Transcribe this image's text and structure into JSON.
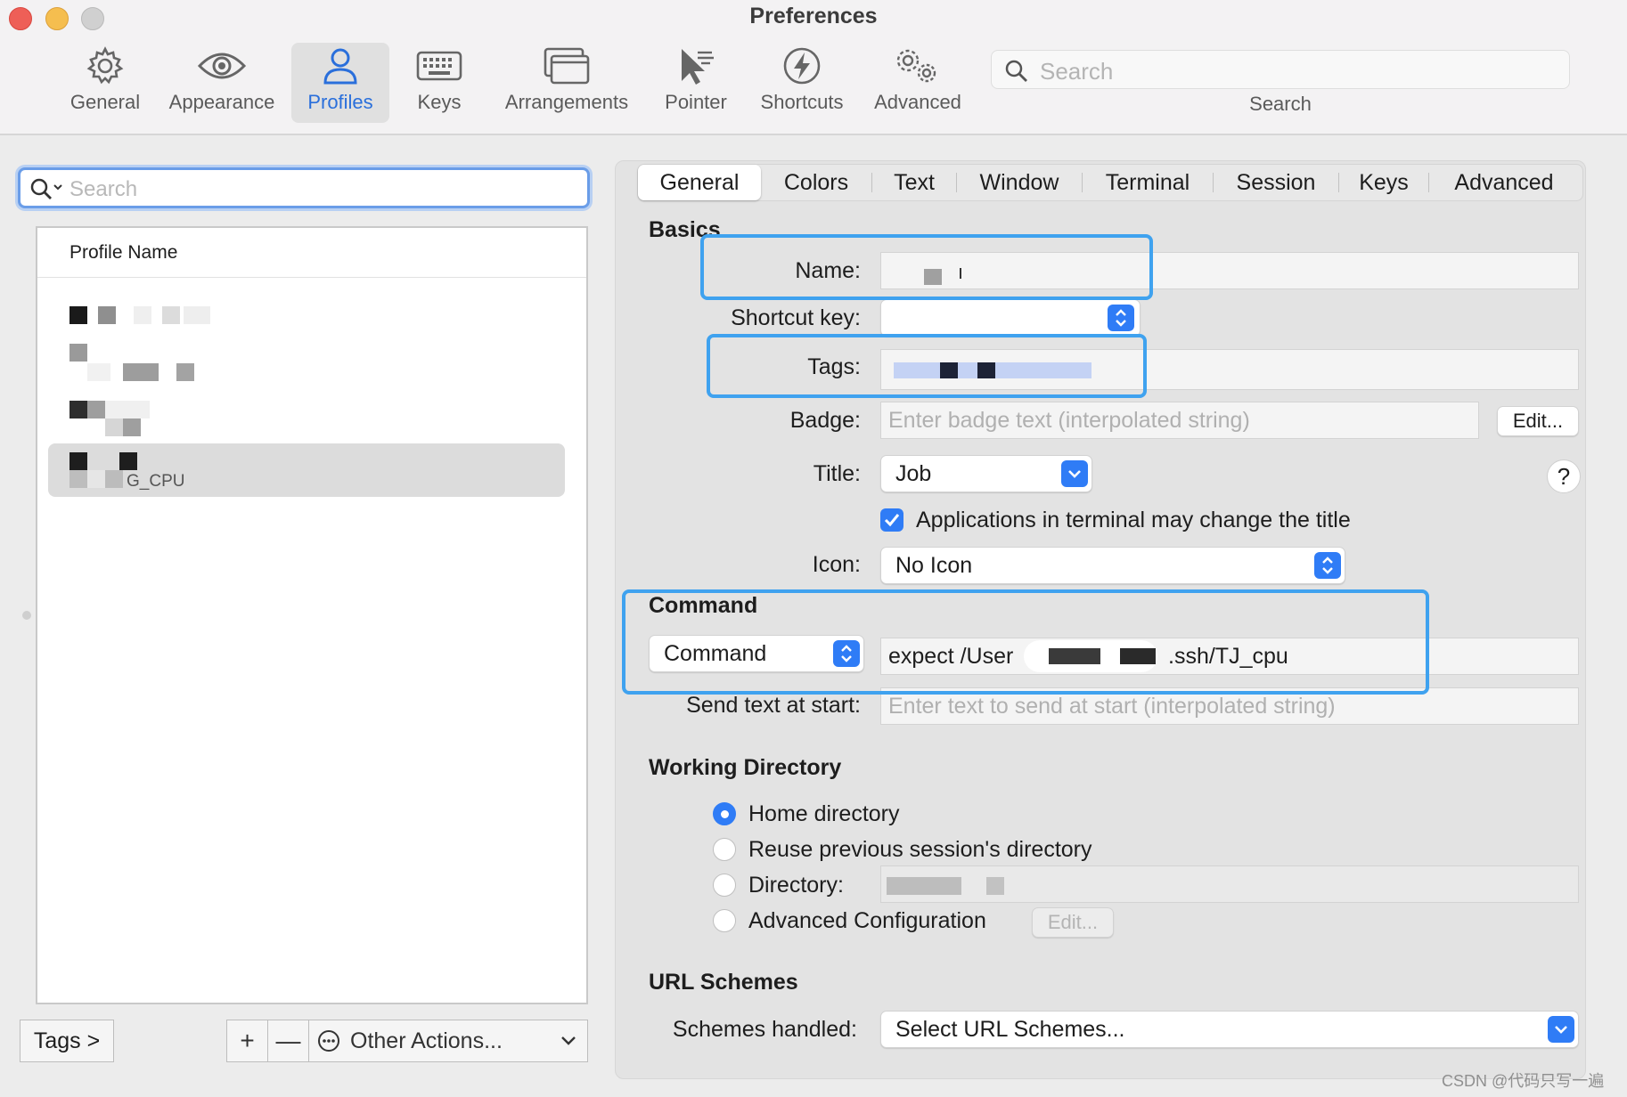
{
  "window": {
    "title": "Preferences"
  },
  "toolbar": {
    "items": [
      {
        "label": "General",
        "icon": "gear-icon"
      },
      {
        "label": "Appearance",
        "icon": "eye-icon"
      },
      {
        "label": "Profiles",
        "icon": "person-icon"
      },
      {
        "label": "Keys",
        "icon": "keyboard-icon"
      },
      {
        "label": "Arrangements",
        "icon": "windows-icon"
      },
      {
        "label": "Pointer",
        "icon": "cursor-icon"
      },
      {
        "label": "Shortcuts",
        "icon": "bolt-icon"
      },
      {
        "label": "Advanced",
        "icon": "gears-icon"
      }
    ],
    "active": "Profiles",
    "search_placeholder": "Search",
    "search_label": "Search"
  },
  "profiles": {
    "search_placeholder": "Search",
    "column_header": "Profile Name",
    "selected_suffix": "G_CPU",
    "tags_button": "Tags >",
    "add_button": "+",
    "remove_button": "—",
    "other_actions": "Other Actions..."
  },
  "tabs": [
    "General",
    "Colors",
    "Text",
    "Window",
    "Terminal",
    "Session",
    "Keys",
    "Advanced"
  ],
  "active_tab": "General",
  "basics": {
    "section": "Basics",
    "name_label": "Name:",
    "shortcut_label": "Shortcut key:",
    "tags_label": "Tags:",
    "badge_label": "Badge:",
    "badge_placeholder": "Enter badge text (interpolated string)",
    "edit_button": "Edit...",
    "title_label": "Title:",
    "title_value": "Job",
    "help": "?",
    "app_change_title": "Applications in terminal may change the title",
    "icon_label": "Icon:",
    "icon_value": "No Icon"
  },
  "command": {
    "section": "Command",
    "type_value": "Command",
    "value_prefix": "expect /User",
    "value_suffix": ".ssh/TJ_cpu",
    "send_text_label": "Send text at start:",
    "send_text_placeholder": "Enter text to send at start (interpolated string)"
  },
  "working_directory": {
    "section": "Working Directory",
    "options": [
      "Home directory",
      "Reuse previous session's directory",
      "Directory:",
      "Advanced Configuration"
    ],
    "selected": "Home directory",
    "edit_button": "Edit..."
  },
  "url_schemes": {
    "section": "URL Schemes",
    "label": "Schemes handled:",
    "value": "Select URL Schemes..."
  },
  "watermark": "CSDN @代码只写一遍",
  "colors": {
    "accent": "#2f7cf6",
    "highlight": "#3fa2ef"
  }
}
